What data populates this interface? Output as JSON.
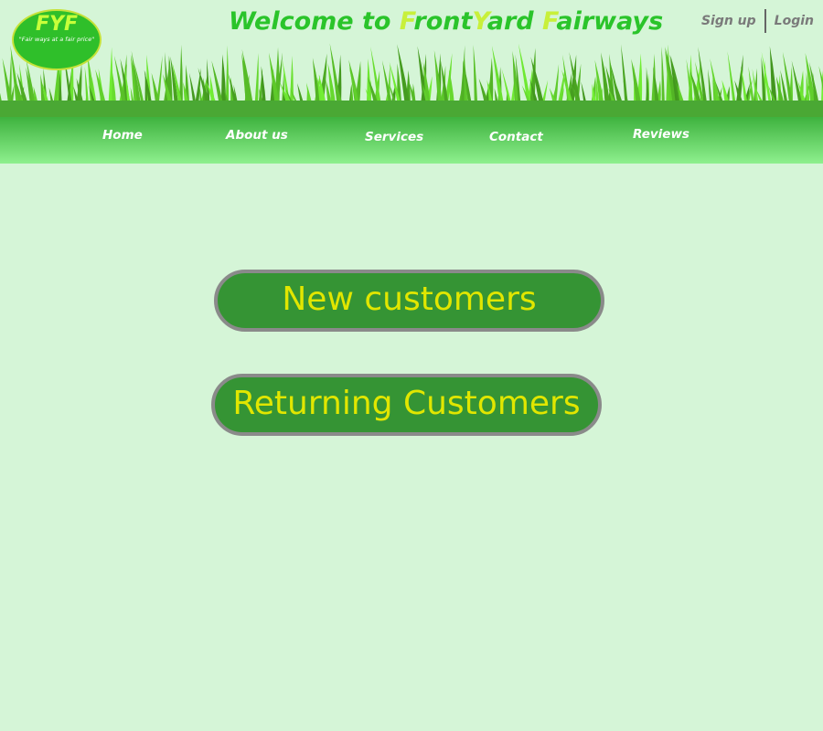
{
  "logo": {
    "mark": "FYF",
    "tagline": "\"Fair ways at a fair price\""
  },
  "welcome": {
    "prefix": "Welcome to ",
    "part1_initial": "F",
    "part1_rest": "ront",
    "part2_initial": "Y",
    "part2_rest": "ard ",
    "part3_initial": "F",
    "part3_rest": "airways"
  },
  "auth": {
    "signup": "Sign up",
    "login": "Login"
  },
  "nav": [
    "Home",
    "About us",
    "Services",
    "Contact",
    "Reviews"
  ],
  "buttons": {
    "new_customers": "New customers",
    "returning_customers": "Returning Customers"
  },
  "colors": {
    "background": "#d5f5d7",
    "nav_gradient_top": "#3eb23e",
    "nav_gradient_bottom": "#8ef08e",
    "button_fill": "#359434",
    "button_text": "#e1e600",
    "button_border": "#8a8a8a",
    "title_green": "#2ac42a",
    "title_highlight": "#c8f03a"
  }
}
